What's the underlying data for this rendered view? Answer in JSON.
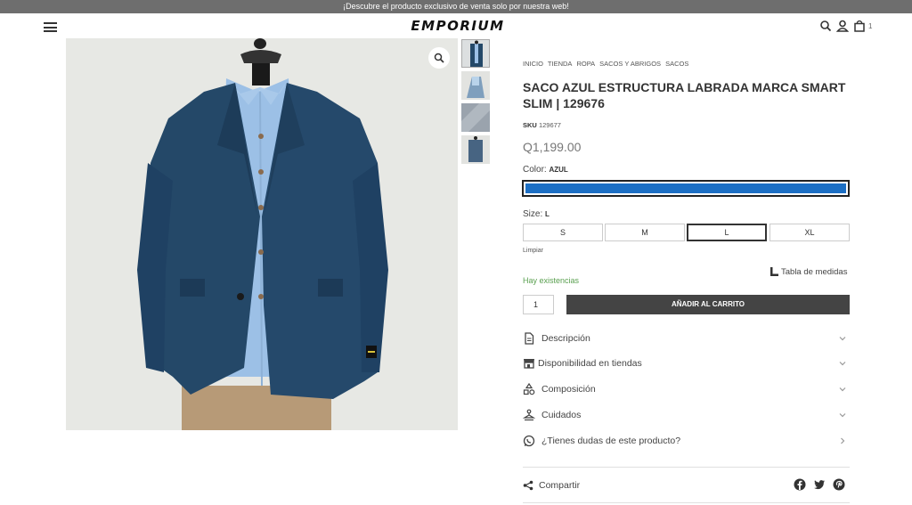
{
  "announcement": "¡Descubre el producto exclusivo de venta solo por nuestra web!",
  "header": {
    "logo": "EMPORIUM",
    "cart_count": "1",
    "icons": [
      "menu-icon",
      "search-icon",
      "user-icon",
      "cart-icon"
    ]
  },
  "gallery": {
    "thumb_count": 4
  },
  "breadcrumb": [
    "INICIO",
    "TIENDA",
    "ROPA",
    "SACOS Y ABRIGOS",
    "SACOS"
  ],
  "product": {
    "title": "SACO AZUL ESTRUCTURA LABRADA MARCA SMART SLIM | 129676",
    "sku_label": "SKU",
    "sku": "129677",
    "price": "Q1,199.00",
    "color_label": "Color:",
    "color_value": "AZUL",
    "swatch_color": "#1c6fc4",
    "size_label": "Size:",
    "size_value": "L",
    "sizes": [
      "S",
      "M",
      "L",
      "XL"
    ],
    "selected_size": "L",
    "clear_label": "Limpiar",
    "measures_label": "Tabla de medidas",
    "stock": "Hay existencias",
    "quantity": "1",
    "add_to_cart": "AÑADIR AL CARRITO"
  },
  "accordions": [
    {
      "label": "Descripción",
      "icon": "document-icon"
    },
    {
      "label": "Disponibilidad en tiendas",
      "icon": "store-icon"
    },
    {
      "label": "Composición",
      "icon": "shapes-icon"
    },
    {
      "label": "Cuidados",
      "icon": "care-icon"
    },
    {
      "label": "¿Tienes dudas de este producto?",
      "icon": "whatsapp-icon"
    }
  ],
  "share": {
    "label": "Compartir",
    "networks": [
      "facebook-icon",
      "twitter-icon",
      "pinterest-icon"
    ]
  },
  "colors": {
    "topbar": "#6e6e6e",
    "button": "#444444",
    "stock": "#5aa050",
    "jacket": "#244868"
  }
}
